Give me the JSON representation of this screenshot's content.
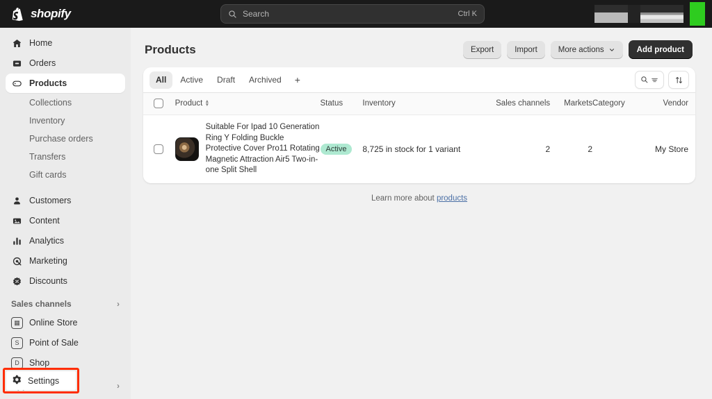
{
  "topbar": {
    "brand_name": "shopify",
    "brand_icon": "shopify-bag-icon",
    "search": {
      "placeholder": "Search",
      "shortcut": "Ctrl K",
      "icon": "search-icon"
    }
  },
  "sidebar": {
    "items": [
      {
        "label": "Home",
        "icon": "home-icon"
      },
      {
        "label": "Orders",
        "icon": "orders-inbox-icon"
      },
      {
        "label": "Products",
        "icon": "product-tag-icon",
        "active": true
      }
    ],
    "product_subitems": [
      {
        "label": "Collections"
      },
      {
        "label": "Inventory"
      },
      {
        "label": "Purchase orders"
      },
      {
        "label": "Transfers"
      },
      {
        "label": "Gift cards"
      }
    ],
    "items2": [
      {
        "label": "Customers",
        "icon": "person-icon"
      },
      {
        "label": "Content",
        "icon": "content-image-icon"
      },
      {
        "label": "Analytics",
        "icon": "analytics-bars-icon"
      },
      {
        "label": "Marketing",
        "icon": "marketing-target-icon"
      },
      {
        "label": "Discounts",
        "icon": "discount-tag-icon"
      }
    ],
    "sales_channels": {
      "label": "Sales channels",
      "chevron": "chevron-right-icon",
      "items": [
        {
          "label": "Online Store",
          "icon": "online-store-icon"
        },
        {
          "label": "Point of Sale",
          "icon": "point-of-sale-icon"
        },
        {
          "label": "Shop",
          "icon": "shop-icon"
        }
      ]
    },
    "apps": {
      "label": "Apps",
      "chevron": "chevron-right-icon"
    },
    "settings": {
      "label": "Settings",
      "icon": "gear-icon",
      "highlight_color": "#ff2d00"
    }
  },
  "page": {
    "title": "Products",
    "buttons": {
      "export": "Export",
      "import": "Import",
      "more_actions": "More actions",
      "more_actions_chevron": "chevron-down-icon",
      "add_product": "Add product"
    }
  },
  "tabs": {
    "items": [
      {
        "label": "All",
        "selected": true
      },
      {
        "label": "Active",
        "selected": false
      },
      {
        "label": "Draft",
        "selected": false
      },
      {
        "label": "Archived",
        "selected": false
      }
    ],
    "add_label": "+",
    "tools": [
      {
        "name": "search-filter-icon"
      },
      {
        "name": "sort-icon"
      }
    ]
  },
  "table": {
    "columns": [
      "Product",
      "Status",
      "Inventory",
      "Sales channels",
      "Markets",
      "Category",
      "Vendor"
    ],
    "sort_icon": "sort-arrows-icon",
    "rows": [
      {
        "thumbnail": "product-thumbnail",
        "product": "Suitable For Ipad 10 Generation Ring Y Folding Buckle Protective Cover Pro11 Rotating Magnetic Attraction Air5 Two-in-one Split Shell",
        "status": "Active",
        "status_color": "#aee9d1",
        "inventory": "8,725 in stock for 1 variant",
        "sales_channels": "2",
        "markets": "2",
        "category": "",
        "vendor": "My Store"
      }
    ]
  },
  "footer": {
    "text": "Learn more about",
    "link": "products"
  }
}
